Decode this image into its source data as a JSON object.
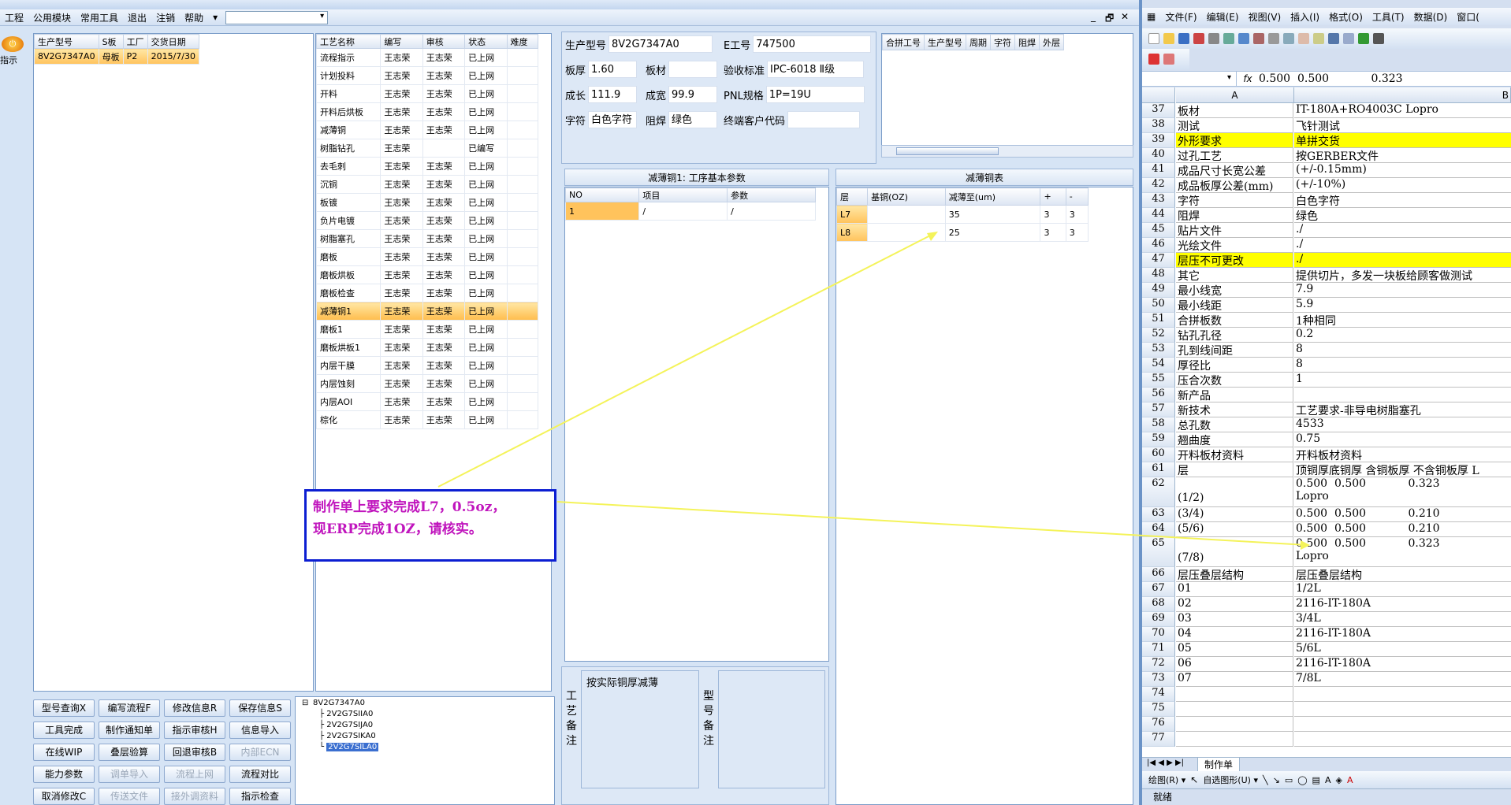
{
  "erp": {
    "menu": [
      "工程",
      "公用模块",
      "常用工具",
      "退出",
      "注销",
      "帮助"
    ],
    "menu_extra": "▾",
    "window_controls": [
      "_",
      "🗗",
      "✕"
    ],
    "guide_label": "指示",
    "products": {
      "headers": [
        "生产型号",
        "S板",
        "工厂",
        "交货日期"
      ],
      "rows": [
        [
          "8V2G7347A0",
          "母板",
          "P2",
          "2015/7/30"
        ]
      ]
    },
    "processes": {
      "headers": [
        "工艺名称",
        "编写",
        "审核",
        "状态",
        "难度"
      ],
      "rows": [
        [
          "流程指示",
          "王志荣",
          "王志荣",
          "已上网",
          ""
        ],
        [
          "计划投料",
          "王志荣",
          "王志荣",
          "已上网",
          ""
        ],
        [
          "开料",
          "王志荣",
          "王志荣",
          "已上网",
          ""
        ],
        [
          "开料后烘板",
          "王志荣",
          "王志荣",
          "已上网",
          ""
        ],
        [
          "减薄铜",
          "王志荣",
          "王志荣",
          "已上网",
          ""
        ],
        [
          "树脂钻孔",
          "王志荣",
          "",
          "已编写",
          ""
        ],
        [
          "去毛刺",
          "王志荣",
          "王志荣",
          "已上网",
          ""
        ],
        [
          "沉铜",
          "王志荣",
          "王志荣",
          "已上网",
          ""
        ],
        [
          "板镀",
          "王志荣",
          "王志荣",
          "已上网",
          ""
        ],
        [
          "负片电镀",
          "王志荣",
          "王志荣",
          "已上网",
          ""
        ],
        [
          "树脂塞孔",
          "王志荣",
          "王志荣",
          "已上网",
          ""
        ],
        [
          "磨板",
          "王志荣",
          "王志荣",
          "已上网",
          ""
        ],
        [
          "磨板烘板",
          "王志荣",
          "王志荣",
          "已上网",
          ""
        ],
        [
          "磨板检查",
          "王志荣",
          "王志荣",
          "已上网",
          ""
        ],
        [
          "减薄铜1",
          "王志荣",
          "王志荣",
          "已上网",
          ""
        ],
        [
          "磨板1",
          "王志荣",
          "王志荣",
          "已上网",
          ""
        ],
        [
          "磨板烘板1",
          "王志荣",
          "王志荣",
          "已上网",
          ""
        ],
        [
          "内层干膜",
          "王志荣",
          "王志荣",
          "已上网",
          ""
        ],
        [
          "内层蚀刻",
          "王志荣",
          "王志荣",
          "已上网",
          ""
        ],
        [
          "内层AOI",
          "王志荣",
          "王志荣",
          "已上网",
          ""
        ],
        [
          "棕化",
          "王志荣",
          "王志荣",
          "已上网",
          ""
        ]
      ],
      "selected_index": 14
    },
    "info": {
      "prod_model_label": "生产型号",
      "prod_model": "8V2G7347A0",
      "e_no_label": "E工号",
      "e_no": "747500",
      "thick_label": "板厚",
      "thick": "1.60",
      "material_label": "板材",
      "material": "",
      "accept_label": "验收标准",
      "accept": "IPC-6018 Ⅱ级",
      "len_label": "成长",
      "len": "111.9",
      "wid_label": "成宽",
      "wid": "99.9",
      "pnl_label": "PNL规格",
      "pnl": "1P=19U",
      "char_label": "字符",
      "char": "白色字符",
      "mask_label": "阻焊",
      "mask": "绿色",
      "cust_label": "终端客户代码",
      "cust": ""
    },
    "merge": {
      "headers": [
        "合拼工号",
        "生产型号",
        "周期",
        "字符",
        "阻焊",
        "外层"
      ]
    },
    "param": {
      "title": "减薄铜1: 工序基本参数",
      "headers": [
        "NO",
        "项目",
        "参数"
      ],
      "rows": [
        [
          "1",
          "/",
          "/"
        ]
      ]
    },
    "thin": {
      "title": "减薄铜表",
      "headers": [
        "层",
        "基铜(OZ)",
        "减薄至(um)",
        "+",
        "-"
      ],
      "rows": [
        [
          "L7",
          "",
          "35",
          "3",
          "3"
        ],
        [
          "L8",
          "",
          "25",
          "3",
          "3"
        ]
      ]
    },
    "notes": {
      "left_label": "工艺备注",
      "left_text": "按实际铜厚减薄",
      "right_label": "型号备注",
      "right_text": ""
    },
    "buttons": [
      {
        "label": "型号查询X",
        "dis": false
      },
      {
        "label": "编写流程F",
        "dis": false
      },
      {
        "label": "修改信息R",
        "dis": false
      },
      {
        "label": "保存信息S",
        "dis": false
      },
      {
        "label": "工具完成",
        "dis": false
      },
      {
        "label": "制作通知单",
        "dis": false
      },
      {
        "label": "指示审核H",
        "dis": false
      },
      {
        "label": "信息导入",
        "dis": false
      },
      {
        "label": "在线WIP",
        "dis": false
      },
      {
        "label": "叠层验算",
        "dis": false
      },
      {
        "label": "回退审核B",
        "dis": false
      },
      {
        "label": "内部ECN",
        "dis": true
      },
      {
        "label": "能力参数",
        "dis": false
      },
      {
        "label": "调单导入",
        "dis": true
      },
      {
        "label": "流程上网",
        "dis": true
      },
      {
        "label": "流程对比",
        "dis": false
      },
      {
        "label": "取消修改C",
        "dis": false
      },
      {
        "label": "传送文件",
        "dis": true
      },
      {
        "label": "接外调资料",
        "dis": true
      },
      {
        "label": "指示检查",
        "dis": false
      }
    ],
    "tree": {
      "root": "8V2G7347A0",
      "children": [
        "2V2G7SIIA0",
        "2V2G7SIJA0",
        "2V2G7SIKA0",
        "2V2G7SILA0"
      ]
    },
    "callout": {
      "line1": "制作单上要求完成L7，0.5oz，",
      "line2": "现ERP完成1OZ，请核实。"
    }
  },
  "excel": {
    "menu": [
      "文件(F)",
      "编辑(E)",
      "视图(V)",
      "插入(I)",
      "格式(O)",
      "工具(T)",
      "数据(D)",
      "窗口("
    ],
    "formula_value": "0.500  0.500            0.323",
    "col_a": "A",
    "col_b": "B",
    "rows": [
      {
        "n": "37",
        "a": "板材",
        "b": "IT-180A+RO4003C Lopro"
      },
      {
        "n": "38",
        "a": "测试",
        "b": "飞针测试"
      },
      {
        "n": "39",
        "a": "外形要求",
        "b": "单拼交货",
        "yel": true
      },
      {
        "n": "40",
        "a": "过孔工艺",
        "b": "按GERBER文件"
      },
      {
        "n": "41",
        "a": "成品尺寸长宽公差",
        "b": "(+/-0.15mm)"
      },
      {
        "n": "42",
        "a": "成品板厚公差(mm)",
        "b": "(+/-10%)"
      },
      {
        "n": "43",
        "a": "字符",
        "b": "白色字符"
      },
      {
        "n": "44",
        "a": "阻焊",
        "b": "绿色"
      },
      {
        "n": "45",
        "a": "贴片文件",
        "b": "./"
      },
      {
        "n": "46",
        "a": "光绘文件",
        "b": "./"
      },
      {
        "n": "47",
        "a": "层压不可更改",
        "b": "./",
        "yel": true
      },
      {
        "n": "48",
        "a": "其它",
        "b": "提供切片，多发一块板给顾客做测试"
      },
      {
        "n": "49",
        "a": "最小线宽",
        "b": "7.9"
      },
      {
        "n": "50",
        "a": "最小线距",
        "b": "5.9"
      },
      {
        "n": "51",
        "a": "合拼板数",
        "b": "1种相同"
      },
      {
        "n": "52",
        "a": "钻孔孔径",
        "b": "0.2"
      },
      {
        "n": "53",
        "a": "孔到线间距",
        "b": "8"
      },
      {
        "n": "54",
        "a": "厚径比",
        "b": "8"
      },
      {
        "n": "55",
        "a": "压合次数",
        "b": "1"
      },
      {
        "n": "56",
        "a": "新产品",
        "b": ""
      },
      {
        "n": "57",
        "a": "新技术",
        "b": "工艺要求-非导电树脂塞孔"
      },
      {
        "n": "58",
        "a": "总孔数",
        "b": "4533"
      },
      {
        "n": "59",
        "a": "翘曲度",
        "b": "0.75"
      },
      {
        "n": "60",
        "a": "开料板材资料",
        "b": "开料板材资料"
      },
      {
        "n": "61",
        "a": "层",
        "b": "顶铜厚底铜厚 含铜板厚 不含铜板厚 L"
      },
      {
        "n": "62",
        "a": "(1/2)",
        "b": "0.500  0.500            0.323",
        "b2": "Lopro",
        "tall": true
      },
      {
        "n": "63",
        "a": "(3/4)",
        "b": "0.500  0.500            0.210"
      },
      {
        "n": "64",
        "a": "(5/6)",
        "b": "0.500  0.500            0.210"
      },
      {
        "n": "65",
        "a": "(7/8)",
        "b": "0.500  0.500            0.323",
        "b2": "Lopro",
        "tall": true
      },
      {
        "n": "66",
        "a": "层压叠层结构",
        "b": "层压叠层结构"
      },
      {
        "n": "67",
        "a": "01",
        "b": "1/2L"
      },
      {
        "n": "68",
        "a": "02",
        "b": "2116-IT-180A"
      },
      {
        "n": "69",
        "a": "03",
        "b": "3/4L"
      },
      {
        "n": "70",
        "a": "04",
        "b": "2116-IT-180A"
      },
      {
        "n": "71",
        "a": "05",
        "b": "5/6L"
      },
      {
        "n": "72",
        "a": "06",
        "b": "2116-IT-180A"
      },
      {
        "n": "73",
        "a": "07",
        "b": "7/8L"
      },
      {
        "n": "74",
        "a": "",
        "b": ""
      },
      {
        "n": "75",
        "a": "",
        "b": ""
      },
      {
        "n": "76",
        "a": "",
        "b": ""
      },
      {
        "n": "77",
        "a": "",
        "b": ""
      }
    ],
    "sheet_tab": "制作单",
    "tab_nav": "|◀ ◀ ▶ ▶|",
    "draw_label": "绘图(R) ▾",
    "autoshape_label": "自选图形(U) ▾",
    "status": "就绪"
  },
  "colors": {
    "callout_border": "#0c1ed2",
    "callout_text": "#c015bd",
    "arrow": "#f4f35a",
    "selection": "#ffc35c",
    "highlight": "#ffff00"
  }
}
